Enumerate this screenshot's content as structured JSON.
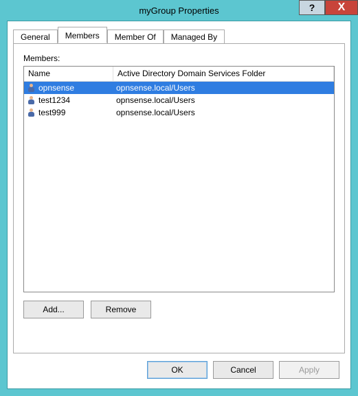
{
  "window": {
    "title": "myGroup Properties",
    "help_symbol": "?",
    "close_symbol": "X"
  },
  "tabs": {
    "general": "General",
    "members": "Members",
    "member_of": "Member Of",
    "managed_by": "Managed By"
  },
  "panel": {
    "members_label": "Members:",
    "columns": {
      "name": "Name",
      "folder": "Active Directory Domain Services Folder"
    },
    "rows": [
      {
        "name": "opnsense",
        "folder": "opnsense.local/Users",
        "selected": true
      },
      {
        "name": "test1234",
        "folder": "opnsense.local/Users",
        "selected": false
      },
      {
        "name": "test999",
        "folder": "opnsense.local/Users",
        "selected": false
      }
    ],
    "buttons": {
      "add": "Add...",
      "remove": "Remove"
    }
  },
  "dialog_buttons": {
    "ok": "OK",
    "cancel": "Cancel",
    "apply": "Apply"
  }
}
